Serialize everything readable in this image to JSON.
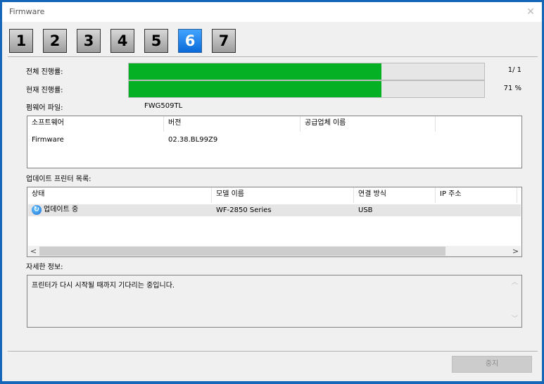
{
  "window": {
    "title": "Firmware",
    "close_glyph": "✕"
  },
  "steps": [
    {
      "label": "1",
      "active": false
    },
    {
      "label": "2",
      "active": false
    },
    {
      "label": "3",
      "active": false
    },
    {
      "label": "4",
      "active": false
    },
    {
      "label": "5",
      "active": false
    },
    {
      "label": "6",
      "active": true
    },
    {
      "label": "7",
      "active": false
    }
  ],
  "progress": {
    "overall_label": "전체 진행률:",
    "overall_value_text": "1/  1",
    "overall_fraction": 0.71,
    "current_label": "현재 진행률:",
    "current_value_text": "71 %",
    "current_fraction": 0.71,
    "fill_color": "#06b025"
  },
  "firmware_file": {
    "label": "펌웨어 파일:",
    "value": "FWG509TL"
  },
  "software_table": {
    "headers": [
      "소프트웨어",
      "버전",
      "공급업체 이름",
      ""
    ],
    "rows": [
      [
        "Firmware",
        "02.38.BL99Z9",
        "",
        ""
      ]
    ]
  },
  "printer_list": {
    "label": "업데이트 프린터 목록:",
    "headers": [
      "상태",
      "모델 이름",
      "연결 방식",
      "IP 주소"
    ],
    "rows": [
      {
        "status_icon": "refresh-icon",
        "status": "업데이트 중",
        "model": "WF-2850 Series",
        "connection": "USB",
        "ip": ""
      }
    ],
    "scroll_left": "<",
    "scroll_right": ">"
  },
  "details": {
    "label": "자세한 정보:",
    "text": "프린터가 다시 시작될 때까지 기다리는 중입니다.",
    "scroll_up": "︿",
    "scroll_down": "﹀"
  },
  "buttons": {
    "stop": "중지"
  },
  "colors": {
    "accent": "#1565b8",
    "active_step": "#0a6ad8"
  }
}
